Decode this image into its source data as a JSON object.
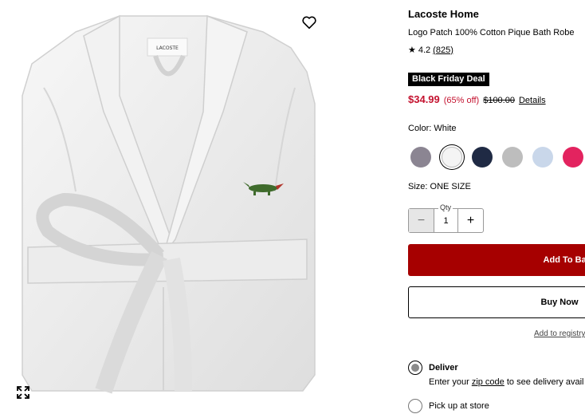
{
  "product": {
    "brand": "Lacoste Home",
    "name": "Logo Patch 100% Cotton Pique Bath Robe",
    "rating_value": "4.2",
    "rating_count": "(825)",
    "image_label": "LACOSTE"
  },
  "promo": {
    "badge": "Black Friday Deal"
  },
  "pricing": {
    "price": "$34.99",
    "discount": "(65% off)",
    "original": "$100.00",
    "details_link": "Details"
  },
  "color": {
    "label": "Color: White",
    "swatches": [
      {
        "name": "gray-mauve",
        "hex": "#8b8592"
      },
      {
        "name": "white",
        "hex": "#f4f4f4",
        "selected": true
      },
      {
        "name": "navy",
        "hex": "#1f2a44"
      },
      {
        "name": "heather-gray",
        "hex": "#bdbdbd"
      },
      {
        "name": "light-blue",
        "hex": "#c9d7ea"
      },
      {
        "name": "pink",
        "hex": "#e3235f"
      }
    ]
  },
  "size": {
    "label": "Size: ONE SIZE"
  },
  "quantity": {
    "label": "Qty",
    "value": "1",
    "minus": "−",
    "plus": "+"
  },
  "actions": {
    "add_to_bag": "Add To Bag",
    "buy_now": "Buy Now",
    "add_to_registry": "Add to registry"
  },
  "fulfillment": {
    "deliver_label": "Deliver",
    "deliver_note_prefix": "Enter your ",
    "deliver_note_link": "zip code",
    "deliver_note_suffix": " to see delivery avail",
    "pickup_label": "Pick up at store"
  },
  "colors": {
    "price_red": "#c4122f",
    "cta_red": "#a60000"
  }
}
